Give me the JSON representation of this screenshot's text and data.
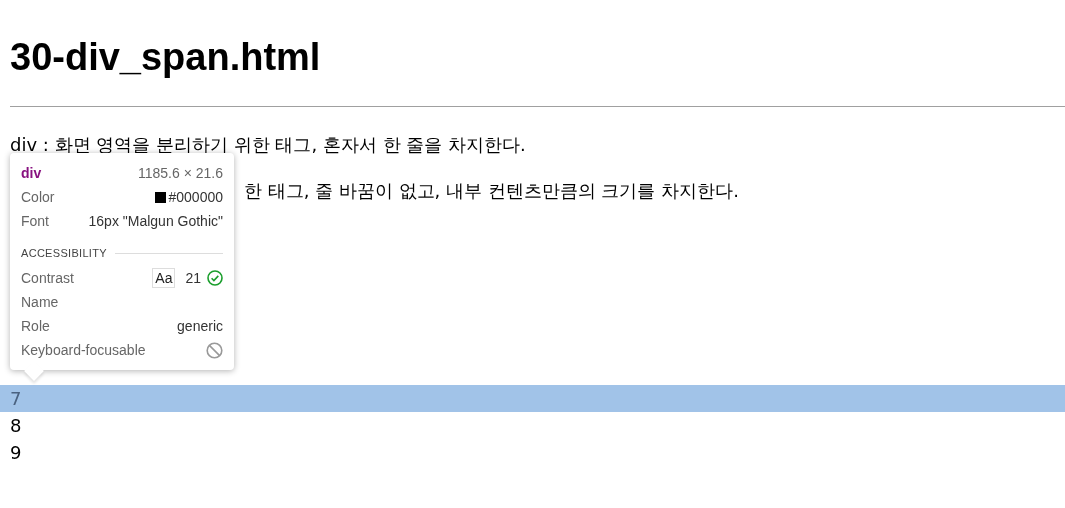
{
  "page": {
    "heading": "30-div_span.html",
    "paragraphs": [
      {
        "text": "div : 화면 영역을 분리하기 위한 태그, 혼자서 한 줄을 차지한다."
      },
      {
        "text": "한 태그, 줄 바꿈이 없고, 내부 컨텐츠만큼의 크기를 차지한다."
      }
    ],
    "lines": [
      {
        "text": "7",
        "selected": true
      },
      {
        "text": "8",
        "selected": false
      },
      {
        "text": "9",
        "selected": false
      }
    ]
  },
  "inspector_tooltip": {
    "tag": "div",
    "size": "1185.6 × 21.6",
    "color_label": "Color",
    "color_value": "#000000",
    "font_label": "Font",
    "font_value": "16px \"Malgun Gothic\"",
    "section": "ACCESSIBILITY",
    "contrast_label": "Contrast",
    "contrast_sample": "Aa",
    "contrast_value": "21",
    "name_label": "Name",
    "role_label": "Role",
    "role_value": "generic",
    "focusable_label": "Keyboard-focusable"
  }
}
